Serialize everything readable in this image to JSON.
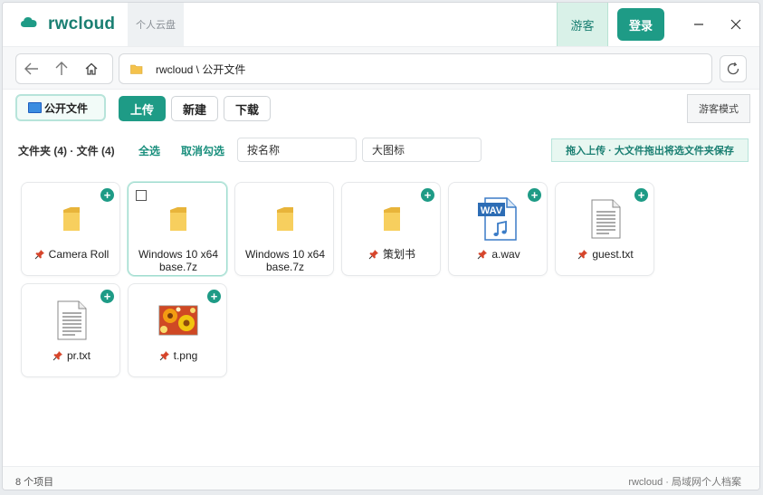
{
  "window": {
    "app_name": "rwcloud",
    "subtitle": "个人云盘",
    "guest_label": "游客",
    "login_label": "登录"
  },
  "nav": {
    "address": "rwcloud \\ 公开文件"
  },
  "toolbar": {
    "location_chip": "公开文件",
    "upload": "上传",
    "new": "新建",
    "download": "下载",
    "guest_mode": "游客模式"
  },
  "filter": {
    "counts": "文件夹 (4) · 文件 (4)",
    "select_all": "全选",
    "deselect": "取消勾选",
    "sort_by": "按名称",
    "view_mode": "大图标",
    "drop_hint": "拖入上传 · 大文件拖出将选文件夹保存"
  },
  "files": [
    {
      "name": "Camera Roll",
      "type": "folder",
      "pinned": true
    },
    {
      "name_line1": "Windows 10 x64",
      "name_line2": "base.7z",
      "type": "folder",
      "pinned": false,
      "selected": true
    },
    {
      "name_line1": "Windows 10 x64",
      "name_line2": "base.7z",
      "type": "folder",
      "pinned": false
    },
    {
      "name": "策划书",
      "type": "folder",
      "pinned": true
    },
    {
      "name": "a.wav",
      "type": "audio",
      "pinned": true
    },
    {
      "name": "guest.txt",
      "type": "text",
      "pinned": true
    },
    {
      "name": "pr.txt",
      "type": "text",
      "pinned": true
    },
    {
      "name": "t.png",
      "type": "image",
      "pinned": true
    }
  ],
  "status": {
    "item_count": "8 个项目",
    "footer": "rwcloud · 局域网个人档案"
  },
  "icons": {
    "logo": "cloud-icon",
    "back": "back-arrow-icon",
    "up": "up-arrow-icon",
    "home": "home-icon",
    "refresh": "refresh-icon",
    "folder": "folder-icon",
    "pin": "pin-icon"
  },
  "colors": {
    "accent": "#1e9b86",
    "accent_light": "#e8f7f1",
    "folder": "#f4c24c",
    "pin": "#d6452b"
  }
}
